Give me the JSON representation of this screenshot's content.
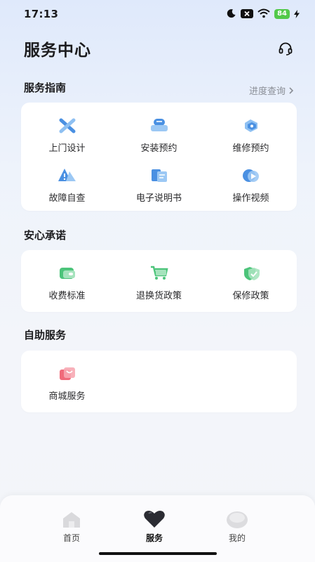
{
  "status_bar": {
    "time": "17:13",
    "battery": "84"
  },
  "header": {
    "title": "服务中心"
  },
  "guide": {
    "title": "服务指南",
    "progress_link": "进度查询",
    "items": [
      {
        "label": "上门设计",
        "icon": "x-tools-icon"
      },
      {
        "label": "安装预约",
        "icon": "install-icon"
      },
      {
        "label": "维修预约",
        "icon": "repair-icon"
      },
      {
        "label": "故障自查",
        "icon": "warning-icon"
      },
      {
        "label": "电子说明书",
        "icon": "manual-icon"
      },
      {
        "label": "操作视频",
        "icon": "video-icon"
      }
    ]
  },
  "promise": {
    "title": "安心承诺",
    "items": [
      {
        "label": "收费标准",
        "icon": "wallet-icon"
      },
      {
        "label": "退换货政策",
        "icon": "cart-icon"
      },
      {
        "label": "保修政策",
        "icon": "shield-check-icon"
      }
    ]
  },
  "self_service": {
    "title": "自助服务",
    "items": [
      {
        "label": "商城服务",
        "icon": "shopping-bag-icon"
      }
    ]
  },
  "tab_bar": {
    "tabs": [
      {
        "label": "首页",
        "icon": "home-icon"
      },
      {
        "label": "服务",
        "icon": "heart-icon"
      },
      {
        "label": "我的",
        "icon": "profile-icon"
      }
    ]
  },
  "colors": {
    "accent_blue": "#4a90e2",
    "accent_green": "#4cc47a",
    "accent_red": "#f06a7a",
    "battery_green": "#52c94a"
  }
}
